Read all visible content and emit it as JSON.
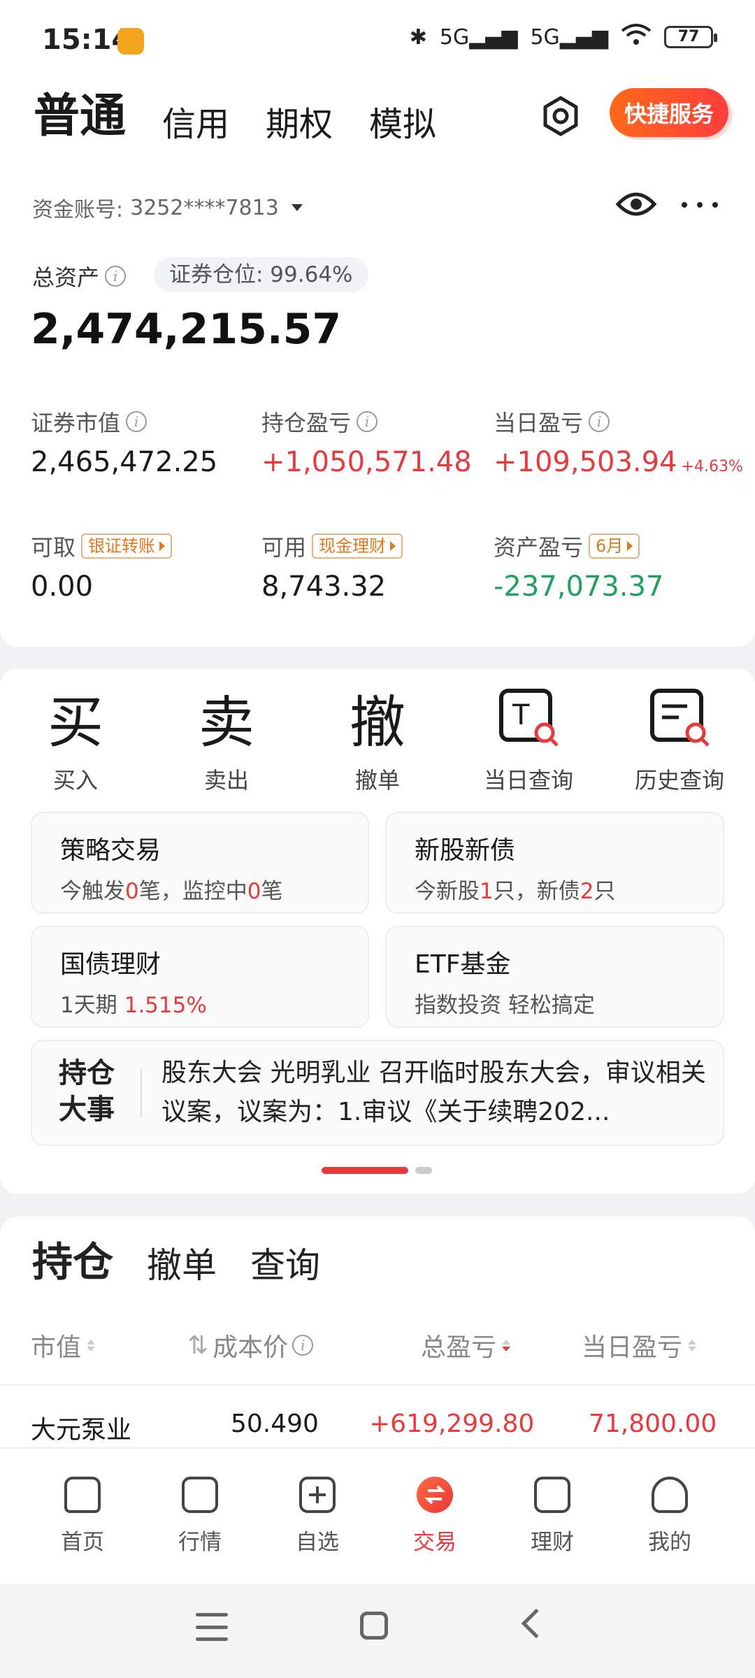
{
  "status_bar": {
    "time": "15:14",
    "network1": "5G",
    "network2": "5G",
    "battery": "77"
  },
  "header": {
    "tabs": [
      "普通",
      "信用",
      "期权",
      "模拟"
    ],
    "quick_service": "快捷服务"
  },
  "account": {
    "label": "资金账号:",
    "number": "3252****7813",
    "total_label": "总资产",
    "position_ratio": "证券仓位: 99.64%",
    "total_value": "2,474,215.57",
    "metrics": [
      {
        "label": "证券市值",
        "value": "2,465,472.25"
      },
      {
        "label": "持仓盈亏",
        "value": "+1,050,571.48"
      },
      {
        "label": "当日盈亏",
        "value": "+109,503.94",
        "pct": "+4.63%"
      },
      {
        "label": "可取",
        "tag": "银证转账",
        "value": "0.00"
      },
      {
        "label": "可用",
        "tag": "现金理财",
        "value": "8,743.32"
      },
      {
        "label": "资产盈亏",
        "tag": "6月",
        "value": "-237,073.37"
      }
    ]
  },
  "actions": [
    {
      "glyph": "买",
      "label": "买入"
    },
    {
      "glyph": "卖",
      "label": "卖出"
    },
    {
      "glyph": "撤",
      "label": "撤单"
    },
    {
      "glyph": "T",
      "label": "当日查询"
    },
    {
      "glyph": "",
      "label": "历史查询"
    }
  ],
  "cards": {
    "strategy": {
      "title": "策略交易",
      "s1": "今触发",
      "n1": "0",
      "s2": "笔，监控中",
      "n2": "0",
      "s3": "笔"
    },
    "ipo": {
      "title": "新股新债",
      "s1": "今新股",
      "n1": "1",
      "s2": "只，新债",
      "n2": "2",
      "s3": "只"
    },
    "bond": {
      "title": "国债理财",
      "s1": "1天期",
      "rate": "1.515%"
    },
    "etf": {
      "title": "ETF基金",
      "sub": "指数投资 轻松搞定"
    }
  },
  "news": {
    "head1": "持仓",
    "head2": "大事",
    "body": "股东大会 光明乳业 召开临时股东大会，审议相关议案，议案为：1.审议《关于续聘202..."
  },
  "holdings": {
    "tabs": [
      "持仓",
      "撤单",
      "查询"
    ],
    "columns": [
      "市值",
      "成本价",
      "总盈亏",
      "当日盈亏"
    ],
    "rows": [
      {
        "name": "大元泵业",
        "cost": "50.490",
        "total_pl": "+619,299.80",
        "day_pl": "71,800.00"
      }
    ]
  },
  "nav": [
    "首页",
    "行情",
    "自选",
    "交易",
    "理财",
    "我的"
  ]
}
